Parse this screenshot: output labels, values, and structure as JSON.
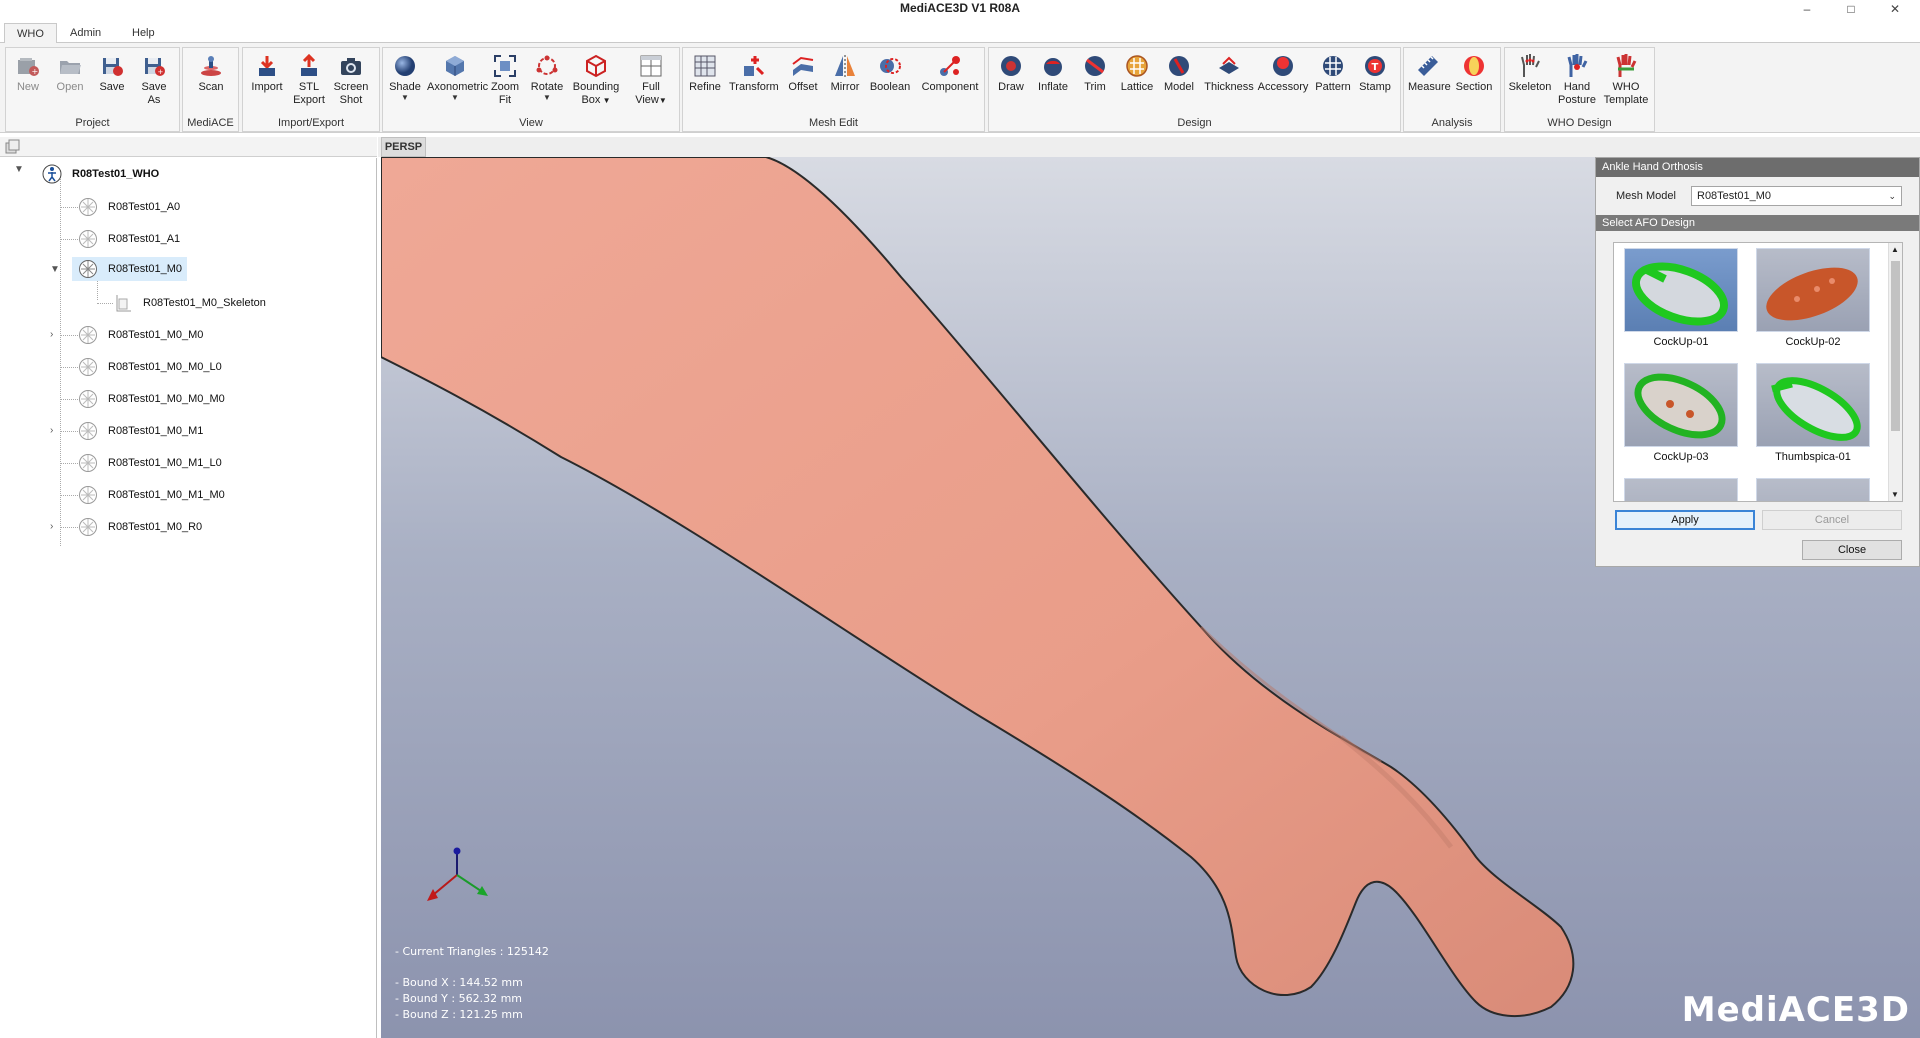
{
  "window": {
    "title": "MediACE3D V1 R08A"
  },
  "menu": {
    "tabs": [
      {
        "label": "WHO",
        "active": true
      },
      {
        "label": "Admin",
        "active": false
      },
      {
        "label": "Help",
        "active": false
      }
    ]
  },
  "ribbon": {
    "groups": [
      {
        "title": "Project",
        "buttons": [
          "New",
          "Open",
          "Save",
          "Save\nAs"
        ]
      },
      {
        "title": "MediACE",
        "buttons": [
          "Scan"
        ]
      },
      {
        "title": "Import/Export",
        "buttons": [
          "Import",
          "STL\nExport",
          "Screen\nShot"
        ]
      },
      {
        "title": "View",
        "buttons": [
          "Shade",
          "Axonometric",
          "Zoom\nFit",
          "Rotate",
          "Bounding\nBox",
          "Full\nView"
        ]
      },
      {
        "title": "Mesh Edit",
        "buttons": [
          "Refine",
          "Transform",
          "Offset",
          "Mirror",
          "Boolean",
          "Component"
        ]
      },
      {
        "title": "Design",
        "buttons": [
          "Draw",
          "Inflate",
          "Trim",
          "Lattice",
          "Model",
          "Thickness",
          "Accessory",
          "Pattern",
          "Stamp"
        ]
      },
      {
        "title": "Analysis",
        "buttons": [
          "Measure",
          "Section"
        ]
      },
      {
        "title": "WHO Design",
        "buttons": [
          "Skeleton",
          "Hand\nPosture",
          "WHO\nTemplate"
        ]
      }
    ]
  },
  "tree": {
    "root": "R08Test01_WHO",
    "items": [
      {
        "label": "R08Test01_A0"
      },
      {
        "label": "R08Test01_A1"
      },
      {
        "label": "R08Test01_M0"
      },
      {
        "label": "R08Test01_M0_Skeleton"
      },
      {
        "label": "R08Test01_M0_M0"
      },
      {
        "label": "R08Test01_M0_M0_L0"
      },
      {
        "label": "R08Test01_M0_M0_M0"
      },
      {
        "label": "R08Test01_M0_M1"
      },
      {
        "label": "R08Test01_M0_M1_L0"
      },
      {
        "label": "R08Test01_M0_M1_M0"
      },
      {
        "label": "R08Test01_M0_R0"
      }
    ]
  },
  "viewport": {
    "tab": "PERSP",
    "info": {
      "triangles": "- Current Triangles : 125142",
      "bound_x": "- Bound X : 144.52 mm",
      "bound_y": "- Bound Y : 562.32 mm",
      "bound_z": "- Bound Z : 121.25 mm"
    },
    "logo": "MediACE3D"
  },
  "dialog": {
    "title": "Ankle Hand Orthosis",
    "mesh_model_label": "Mesh Model",
    "mesh_model_value": "R08Test01_M0",
    "section_title": "Select AFO Design",
    "designs": [
      "CockUp-01",
      "CockUp-02",
      "CockUp-03",
      "Thumbspica-01"
    ],
    "apply_label": "Apply",
    "cancel_label": "Cancel",
    "close_label": "Close"
  },
  "colors": {
    "skin": "#e9a18e",
    "viewport_top": "#d8dbe3",
    "viewport_bottom": "#8c93ae",
    "dialog_header": "#6d6d6d",
    "accent_blue": "#3b84d6"
  }
}
